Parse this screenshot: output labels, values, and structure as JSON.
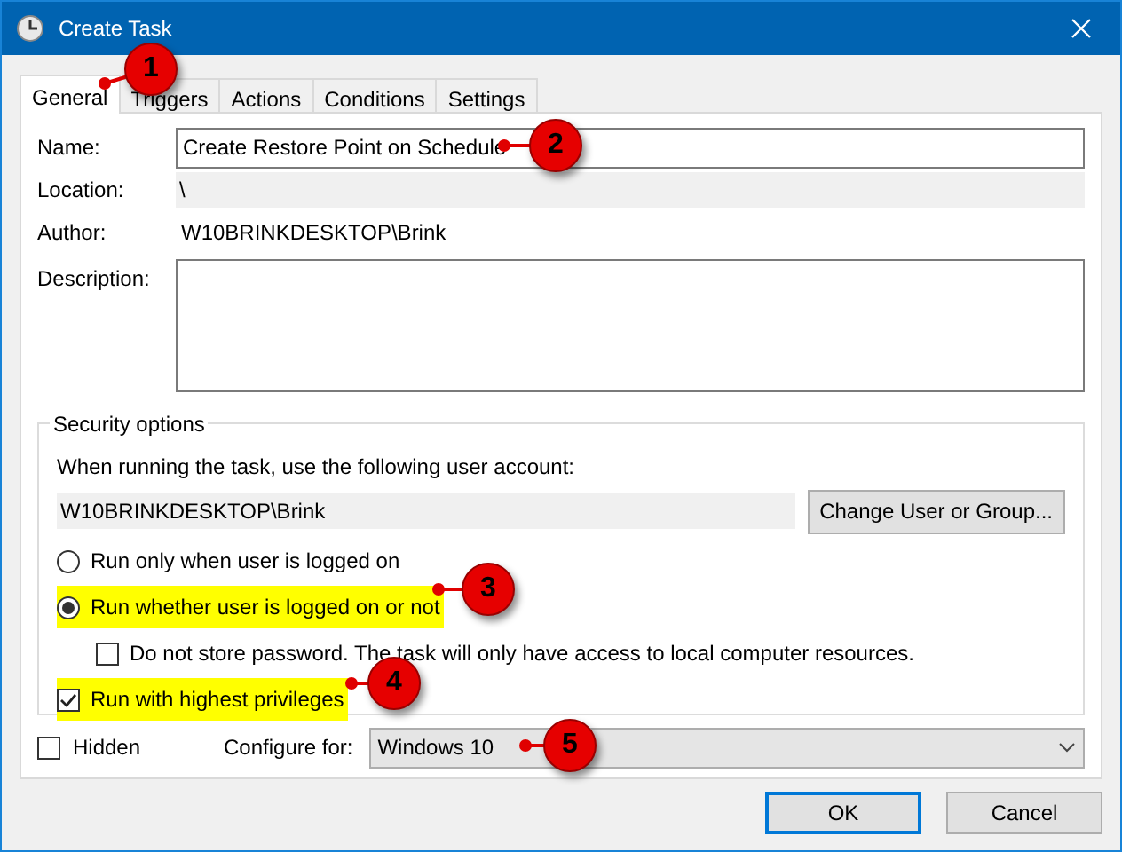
{
  "window": {
    "title": "Create Task"
  },
  "tabs": [
    {
      "label": "General",
      "selected": true
    },
    {
      "label": "Triggers",
      "selected": false
    },
    {
      "label": "Actions",
      "selected": false
    },
    {
      "label": "Conditions",
      "selected": false
    },
    {
      "label": "Settings",
      "selected": false
    }
  ],
  "fields": [
    {
      "kind": "input",
      "label": "Name:",
      "value": "Create Restore Point on Schedule"
    },
    {
      "kind": "readonly",
      "label": "Location:",
      "value": "\\"
    },
    {
      "kind": "plain",
      "label": "Author:",
      "value": "W10BRINKDESKTOP\\Brink"
    },
    {
      "kind": "textarea",
      "label": "Description:"
    }
  ],
  "security": {
    "title": "Security options",
    "prompt": "When running the task, use the following user account:",
    "account": "W10BRINKDESKTOP\\Brink",
    "change_button": "Change User or Group...",
    "options": [
      {
        "kind": "radio",
        "label": "Run only when user is logged on",
        "selected": false,
        "highlighted": false
      },
      {
        "kind": "radio",
        "label": "Run whether user is logged on or not",
        "selected": true,
        "highlighted": true,
        "children": [
          {
            "kind": "checkbox",
            "label": "Do not store password.  The task will only have access to local computer resources.",
            "checked": false,
            "highlighted": false
          }
        ]
      },
      {
        "kind": "checkbox",
        "label": "Run with highest privileges",
        "checked": true,
        "highlighted": true
      }
    ]
  },
  "hidden": {
    "label": "Hidden",
    "checked": false
  },
  "configure": {
    "label": "Configure for:",
    "value": "Windows 10"
  },
  "buttons": [
    {
      "label": "OK",
      "default": true
    },
    {
      "label": "Cancel",
      "default": false
    }
  ],
  "callouts": [
    {
      "number": "1"
    },
    {
      "number": "2"
    },
    {
      "number": "3"
    },
    {
      "number": "4"
    },
    {
      "number": "5"
    }
  ]
}
